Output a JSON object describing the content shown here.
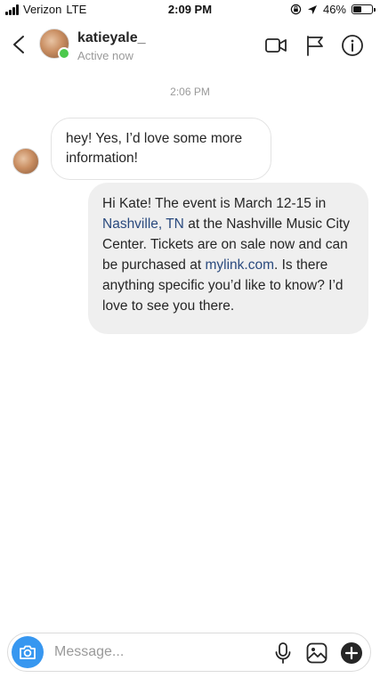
{
  "status_bar": {
    "carrier": "Verizon",
    "network": "LTE",
    "time": "2:09 PM",
    "battery_percent": "46%",
    "battery_level": 0.46
  },
  "header": {
    "username": "katieyale_",
    "status": "Active now",
    "icons": [
      "back-chevron-icon",
      "video-call-icon",
      "report-flag-icon",
      "info-icon"
    ]
  },
  "chat": {
    "timestamp": "2:06 PM",
    "incoming": {
      "text": "hey! Yes, I’d love some more information!"
    },
    "outgoing": {
      "part1": "Hi Kate! The event is March 12-15 in ",
      "link_location": "Nashville, TN",
      "part2": " at the Nashville Music City Center. Tickets are on sale now and can be purchased at ",
      "link_url": "mylink.com",
      "part3": ". Is there anything specific you’d like to know? I’d love to see you there."
    }
  },
  "composer": {
    "placeholder": "Message...",
    "value": "",
    "icons": [
      "camera-icon",
      "microphone-icon",
      "gallery-icon",
      "add-icon"
    ]
  },
  "colors": {
    "accent": "#3797f0",
    "link": "#2a4a7e",
    "online": "#4cc94c",
    "outgoing_bubble": "#efefef"
  }
}
